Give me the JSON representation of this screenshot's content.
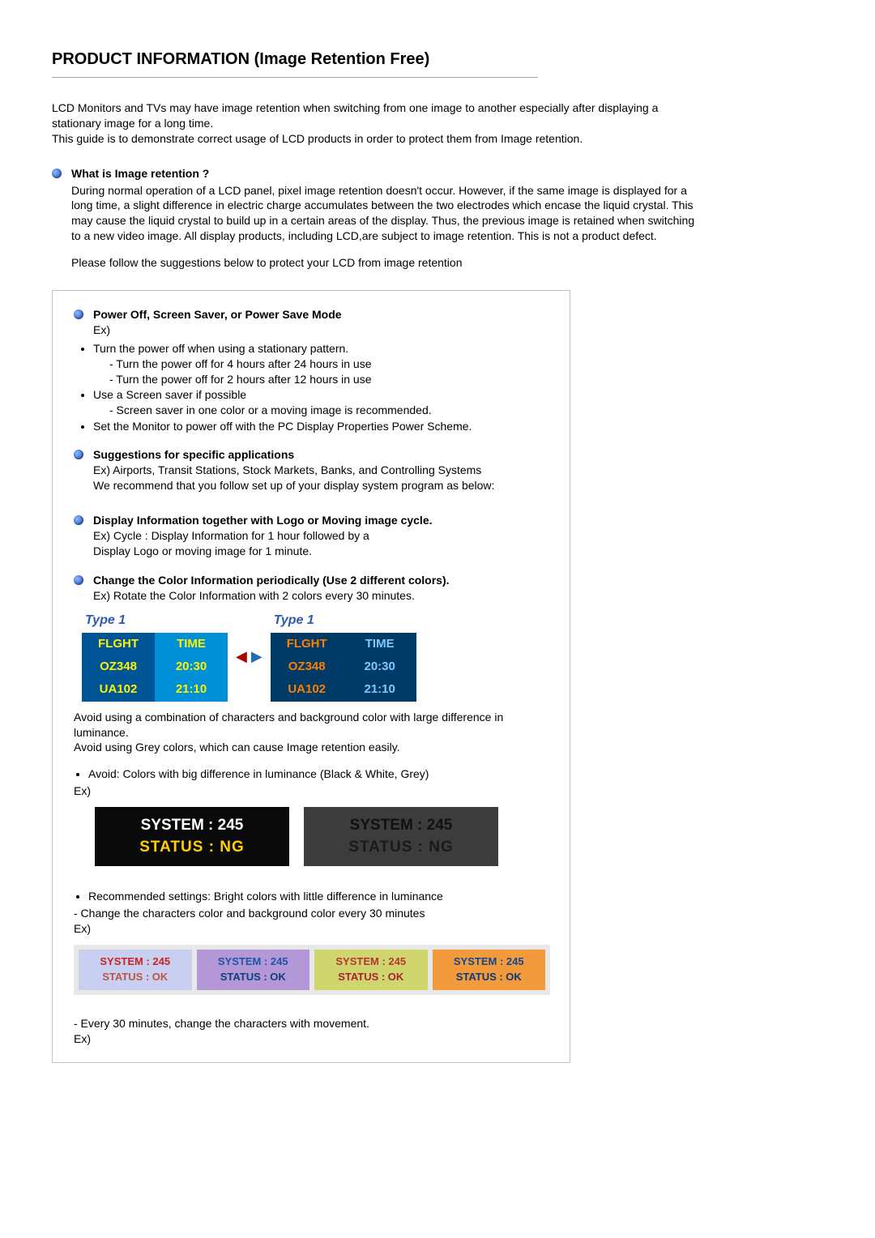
{
  "title": "PRODUCT INFORMATION (Image Retention Free)",
  "intro_a": "LCD Monitors and TVs may have image retention when switching from one image to another especially after displaying a stationary image for a long time.",
  "intro_b": "This guide is to demonstrate correct usage of LCD products in order to protect them from Image retention.",
  "sec1": {
    "head": "What is Image retention ?",
    "body": "During normal operation of a LCD panel, pixel image retention doesn't occur. However, if the same image is displayed for a long time, a slight difference in electric charge accumulates between the two electrodes which encase the liquid crystal. This may cause the liquid crystal to build up in a certain areas of the display. Thus, the previous image is retained when switching to a new video image. All display products, including LCD,are subject to image retention. This is not a product defect."
  },
  "follow": "Please follow the suggestions below to protect your LCD from image retention",
  "secA": {
    "head": "Power Off, Screen Saver, or Power Save Mode",
    "ex": "Ex)",
    "li1": "Turn the power off when using a stationary pattern.",
    "li1a": "- Turn the power off for 4 hours after 24 hours in use",
    "li1b": "- Turn the power off for 2 hours after 12 hours in use",
    "li2": "Use a Screen saver if possible",
    "li2a": "- Screen saver in one color or a moving image is recommended.",
    "li3": "Set the Monitor to power off with the PC Display Properties Power Scheme."
  },
  "secB": {
    "head": "Suggestions for specific applications",
    "l1": "Ex) Airports, Transit Stations, Stock Markets, Banks, and Controlling Systems",
    "l2": "We recommend that you follow set up of your display system program as below:"
  },
  "secC": {
    "head": "Display Information together with Logo or Moving image cycle.",
    "l1": "Ex) Cycle : Display Information for 1 hour followed by a",
    "l2": "Display Logo or moving image for 1 minute."
  },
  "secD": {
    "head": "Change the Color Information periodically (Use 2 different colors).",
    "l1": "Ex) Rotate the Color Information with 2 colors every 30 minutes."
  },
  "tbl": {
    "typeLabel": "Type 1",
    "h1": "FLGHT",
    "h2": "TIME",
    "r1c1": "OZ348",
    "r1c2": "20:30",
    "r2c1": "UA102",
    "r2c2": "21:10"
  },
  "avoid": {
    "a": "Avoid using a combination of characters and background color with large difference in luminance.",
    "b": "Avoid using Grey colors, which can cause Image retention easily.",
    "c": "Avoid: Colors with big difference in luminance (Black & White, Grey)",
    "ex": "Ex)"
  },
  "darkbox": {
    "l1": "SYSTEM : 245",
    "l2": "STATUS : NG"
  },
  "rec": {
    "a": "Recommended settings: Bright colors with little difference in luminance",
    "b": "- Change the characters color and background color every 30 minutes",
    "ex": "Ex)"
  },
  "reccell": {
    "l1": "SYSTEM : 245",
    "l2": "STATUS : OK"
  },
  "tail": {
    "a": "- Every 30 minutes, change the characters with movement.",
    "ex": "Ex)"
  }
}
